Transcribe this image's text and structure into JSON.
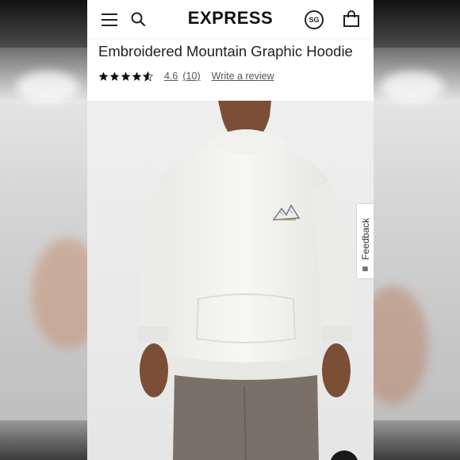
{
  "header": {
    "logo_text": "EXPRESS",
    "region_code": "SG",
    "icons": [
      "menu-icon",
      "search-icon",
      "shopping-bag-icon"
    ]
  },
  "product": {
    "title": "Embroidered Mountain Graphic Hoodie",
    "rating_value": "4.6",
    "rating_count": "(10)",
    "stars_filled": 4.6,
    "stars_total": 5,
    "write_review_label": "Write a review"
  },
  "feedback_tab": {
    "label": "Feedback"
  },
  "colors": {
    "background": "#ffffff",
    "text": "#222222",
    "muted_text": "#555555",
    "hoodie": "#f4f4f1",
    "pants": "#7a7068",
    "skin": "#7b4f36"
  }
}
